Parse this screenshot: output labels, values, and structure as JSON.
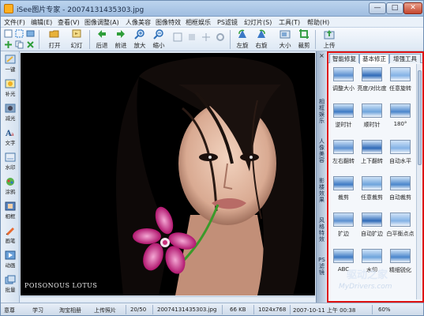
{
  "window": {
    "title": "iSee图片专家 - 2007413143530​3.jpg",
    "controls": [
      "—",
      "□",
      "✕"
    ]
  },
  "menu": [
    "文件(F)",
    "编辑(E)",
    "查看(V)",
    "图像调整(A)",
    "人像美容",
    "图像特效",
    "相框娱乐",
    "PS滤镜",
    "幻灯片(S)",
    "工具(T)",
    "帮助(H)"
  ],
  "toolbar": {
    "items": [
      {
        "label": "打开",
        "icon": "folder-open-icon",
        "color": "#e8b23a"
      },
      {
        "label": "幻灯",
        "icon": "slideshow-icon",
        "color": "#caa24a"
      },
      {
        "label": "后退",
        "icon": "arrow-left-icon",
        "color": "#2f9e3a"
      },
      {
        "label": "前进",
        "icon": "arrow-right-icon",
        "color": "#2f9e3a"
      },
      {
        "label": "放大",
        "icon": "zoom-in-icon",
        "color": "#2e6fb8"
      },
      {
        "label": "缩小",
        "icon": "zoom-out-icon",
        "color": "#2e6fb8"
      },
      {
        "label": "左旋",
        "icon": "rotate-left-icon",
        "color": "#3a78c6"
      },
      {
        "label": "右旋",
        "icon": "rotate-right-icon",
        "color": "#3a78c6"
      },
      {
        "label": "大小",
        "icon": "resize-icon",
        "color": "#5a7fa8"
      },
      {
        "label": "裁剪",
        "icon": "crop-icon",
        "color": "#3aa04a"
      },
      {
        "label": "上传",
        "icon": "upload-icon",
        "color": "#3aa04a"
      }
    ]
  },
  "left_tools": [
    {
      "label": "一键",
      "icon": "magic-wand-icon"
    },
    {
      "label": "补光",
      "icon": "light-icon"
    },
    {
      "label": "减光",
      "icon": "dim-icon"
    },
    {
      "label": "文字",
      "icon": "text-icon"
    },
    {
      "label": "水印",
      "icon": "watermark-icon"
    },
    {
      "label": "涂鸦",
      "icon": "brush-icon"
    },
    {
      "label": "相框",
      "icon": "frame-icon"
    },
    {
      "label": "画笔",
      "icon": "pen-icon"
    },
    {
      "label": "动画",
      "icon": "animation-icon"
    },
    {
      "label": "批量",
      "icon": "batch-icon"
    }
  ],
  "image": {
    "caption": "POISONOUS  LOTUS"
  },
  "side_strip": [
    "相框娱乐",
    "人像美容",
    "影楼效果",
    "风格特效",
    "PS滤镜"
  ],
  "panel": {
    "tabs": [
      "智能修复",
      "基本修正",
      "增强工具"
    ],
    "active_tab": 1,
    "thumb_labels": [
      [
        "调整大小",
        "亮度/对比度",
        "任意旋转"
      ],
      [
        "逆时针",
        "顺时针",
        "180°"
      ],
      [
        "左右翻转",
        "上下翻转",
        "自动水平"
      ],
      [
        "裁剪",
        "任意裁剪",
        "自动裁剪"
      ],
      [
        "扩边",
        "自动扩边",
        "白平衡点点"
      ],
      [
        "ABC",
        "水印",
        "精细锐化"
      ]
    ]
  },
  "status": {
    "items": [
      "意尊",
      "学习",
      "淘宝相册",
      "上传照片"
    ],
    "index": "20/50",
    "filename": "20074131435303.jpg",
    "size": "66 KB",
    "dims": "1024x768",
    "date": "2007-10-11 上午 00:38",
    "zoom": "60%"
  },
  "watermark": {
    "line1": "驱动之家",
    "line2": "MyDrivers.com"
  }
}
